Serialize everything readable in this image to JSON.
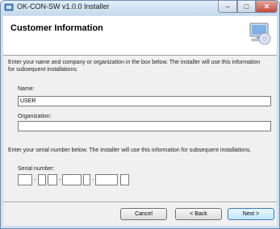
{
  "window": {
    "title": "OK-CON-SW v1.0.0 Installer"
  },
  "header": {
    "title": "Customer Information"
  },
  "intro_text": "Enter your name and company or organization in the box below. The installer will use this information",
  "intro_text_2": "for subsequent installations.",
  "name": {
    "label": "Name:",
    "value": "USER"
  },
  "organization": {
    "label": "Organization:",
    "value": ""
  },
  "serial": {
    "intro": "Enter your serial number below. The installer will use this information for subsequent installations.",
    "label": "Serial number:",
    "separator": "-"
  },
  "buttons": {
    "cancel": "Cancel",
    "back": "< Back",
    "next": "Next >"
  },
  "icons": {
    "app": "installer-icon",
    "banner": "computer-cd-icon",
    "minimize": "minimize-icon",
    "maximize": "maximize-icon",
    "close": "close-icon"
  }
}
